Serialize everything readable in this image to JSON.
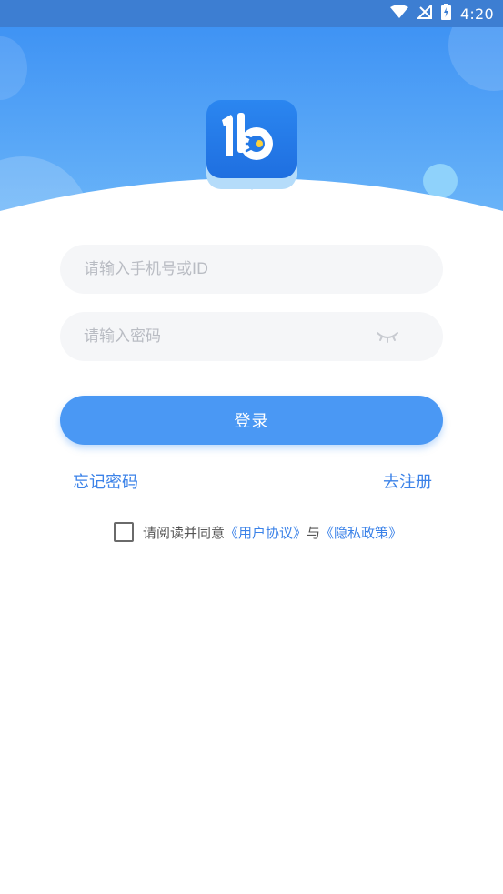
{
  "status_bar": {
    "time": "4:20",
    "icons": [
      "wifi-icon",
      "no-signal-icon",
      "battery-charging-icon"
    ]
  },
  "colors": {
    "status_bar": "#3d7ed2",
    "header_top": "#3f93f4",
    "accent": "#4a98f4",
    "link": "#3b82e8",
    "input_bg": "#f5f6f8"
  },
  "logo": {
    "icon": "app-logo-icon"
  },
  "form": {
    "phone_placeholder": "请输入手机号或ID",
    "phone_value": "",
    "password_placeholder": "请输入密码",
    "password_value": "",
    "password_toggle_icon": "eye-closed-icon",
    "login_label": "登录"
  },
  "links": {
    "forgot_password": "忘记密码",
    "register": "去注册"
  },
  "agreement": {
    "checked": false,
    "prefix": "请阅读并同意",
    "user_agreement": "《用户协议》",
    "conjunction": "与",
    "privacy_policy": "《隐私政策》"
  }
}
